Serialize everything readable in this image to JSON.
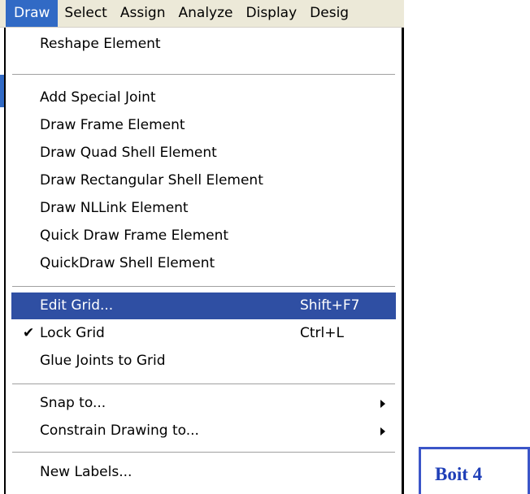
{
  "menubar": {
    "items": [
      "Draw",
      "Select",
      "Assign",
      "Analyze",
      "Display",
      "Desig"
    ]
  },
  "menu": {
    "reshape": "Reshape Element",
    "add_special_joint": "Add Special Joint",
    "draw_frame": "Draw Frame Element",
    "draw_quad_shell": "Draw Quad Shell Element",
    "draw_rect_shell": "Draw Rectangular Shell Element",
    "draw_nllink": "Draw NLLink Element",
    "quick_draw_frame": "Quick Draw Frame Element",
    "quickdraw_shell": "QuickDraw Shell Element",
    "edit_grid": "Edit Grid...",
    "edit_grid_shortcut": "Shift+F7",
    "lock_grid": "Lock Grid",
    "lock_grid_shortcut": "Ctrl+L",
    "lock_grid_checked": true,
    "glue_joints": "Glue Joints to Grid",
    "snap_to": "Snap to...",
    "constrain": "Constrain Drawing to...",
    "new_labels": "New Labels..."
  },
  "annotation": {
    "label": "Boit 4"
  },
  "colors": {
    "highlight": "#2f4fa3",
    "menubar_active": "#316ac5",
    "annotation": "#1f3fb8"
  }
}
